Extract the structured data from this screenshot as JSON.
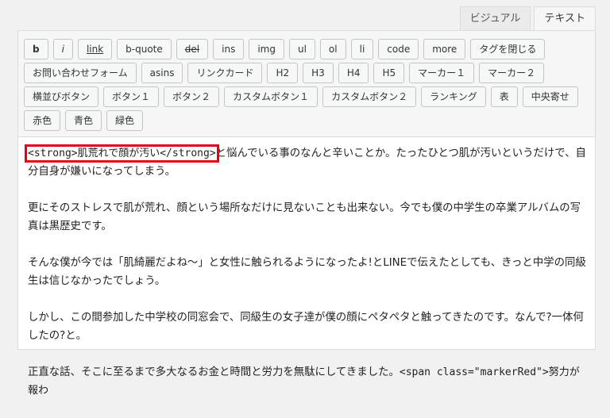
{
  "tabs": {
    "visual": "ビジュアル",
    "text": "テキスト"
  },
  "toolbar": {
    "row1": [
      "b",
      "i",
      "link",
      "b-quote",
      "del",
      "ins",
      "img",
      "ul",
      "ol",
      "li",
      "code",
      "more",
      "タグを閉じる"
    ],
    "row2": [
      "お問い合わせフォーム",
      "asins",
      "リンクカード",
      "H2",
      "H3",
      "H4",
      "H5",
      "マーカー１",
      "マーカー２"
    ],
    "row3": [
      "横並びボタン",
      "ボタン１",
      "ボタン２",
      "カスタムボタン１",
      "カスタムボタン２",
      "ランキング",
      "表",
      "中央寄せ"
    ],
    "row4": [
      "赤色",
      "青色",
      "緑色"
    ]
  },
  "content": {
    "p1_tag": "<strong>肌荒れで顔が汚い</strong>",
    "p1_rest": "と悩んでいる事のなんと辛いことか。たったひとつ肌が汚いというだけで、自分自身が嫌いになってしまう。",
    "p2": "更にそのストレスで肌が荒れ、顔という場所なだけに見ないことも出来ない。今でも僕の中学生の卒業アルバムの写真は黒歴史です。",
    "p3": "そんな僕が今では「肌綺麗だよね〜」と女性に触られるようになったよ!とLINEで伝えたとしても、きっと中学の同級生は信じなかったでしょう。",
    "p4": "しかし、この間参加した中学校の同窓会で、同級生の女子達が僕の顔にペタペタと触ってきたのです。なんで?一体何したの?と。",
    "p5_text": "正直な話、そこに至るまで多大なるお金と時間と労力を無駄にしてきました。",
    "p5_tag": "<span class=\"markerRed\">努力が報わ"
  }
}
